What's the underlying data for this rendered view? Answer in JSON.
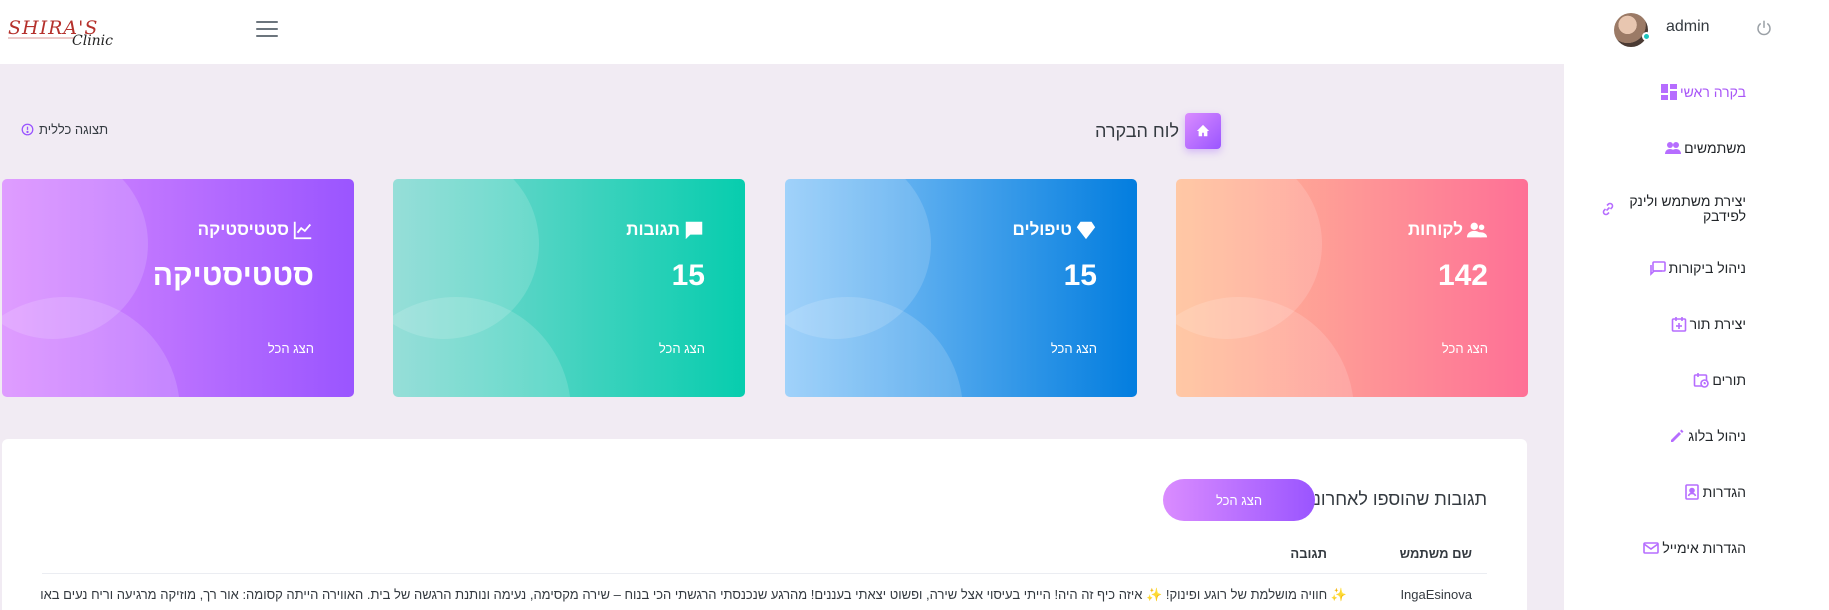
{
  "header": {
    "logo_text": "SHIRA'S Clinic",
    "username": "admin"
  },
  "sidebar": {
    "items": [
      {
        "label": "בקרה ראשי",
        "icon": "dashboard-icon"
      },
      {
        "label": "משתמשים",
        "icon": "users-icon"
      },
      {
        "label": "יצירת משתמש ולינק לפידבק",
        "icon": "link-icon"
      },
      {
        "label": "ניהול ביקורות",
        "icon": "reviews-icon"
      },
      {
        "label": "יצירת תור",
        "icon": "calendar-plus-icon"
      },
      {
        "label": "תורים",
        "icon": "calendar-clock-icon"
      },
      {
        "label": "ניהול בלוג",
        "icon": "pencil-icon"
      },
      {
        "label": "הגדרות",
        "icon": "contact-card-icon"
      },
      {
        "label": "הגדרות אימייל",
        "icon": "email-icon"
      }
    ]
  },
  "page": {
    "title": "לוח הבקרה",
    "overview": "תצוגה כללית"
  },
  "cards": [
    {
      "title": "לקוחות",
      "value": "142",
      "link": "הצג הכל",
      "icon": "users-icon"
    },
    {
      "title": "טיפולים",
      "value": "15",
      "link": "הצג הכל",
      "icon": "diamond-icon"
    },
    {
      "title": "תגובות",
      "value": "15",
      "link": "הצג הכל",
      "icon": "comment-icon"
    },
    {
      "title": "סטטיסטיקה",
      "value": "סטטיסטיקה",
      "link": "הצג הכל",
      "icon": "chart-line-icon"
    }
  ],
  "recent": {
    "title": "תגובות שהוספו לאחרונה",
    "show_all": "הצג הכל",
    "col_user": "שם משתמש",
    "col_response": "תגובה",
    "rows": [
      {
        "user": "IngaEsinova",
        "text": "✨ חוויה מושלמת של רוגע ופינוק! ✨ איזה כיף זה היה! הייתי בעיסוי אצל שירה, ופשוט יצאתי בעננים! מהרגע שנכנסתי הרגשתי הכי בנוח – שירה מקסימה, נעימה ונותנת הרגשה של בית. האווירה הייתה קסומה: אור רך, מוזיקה מרגיעה וריח נעים באו"
      }
    ]
  },
  "colors": {
    "accent": "#9a55ff",
    "background": "#f1ebf3"
  }
}
